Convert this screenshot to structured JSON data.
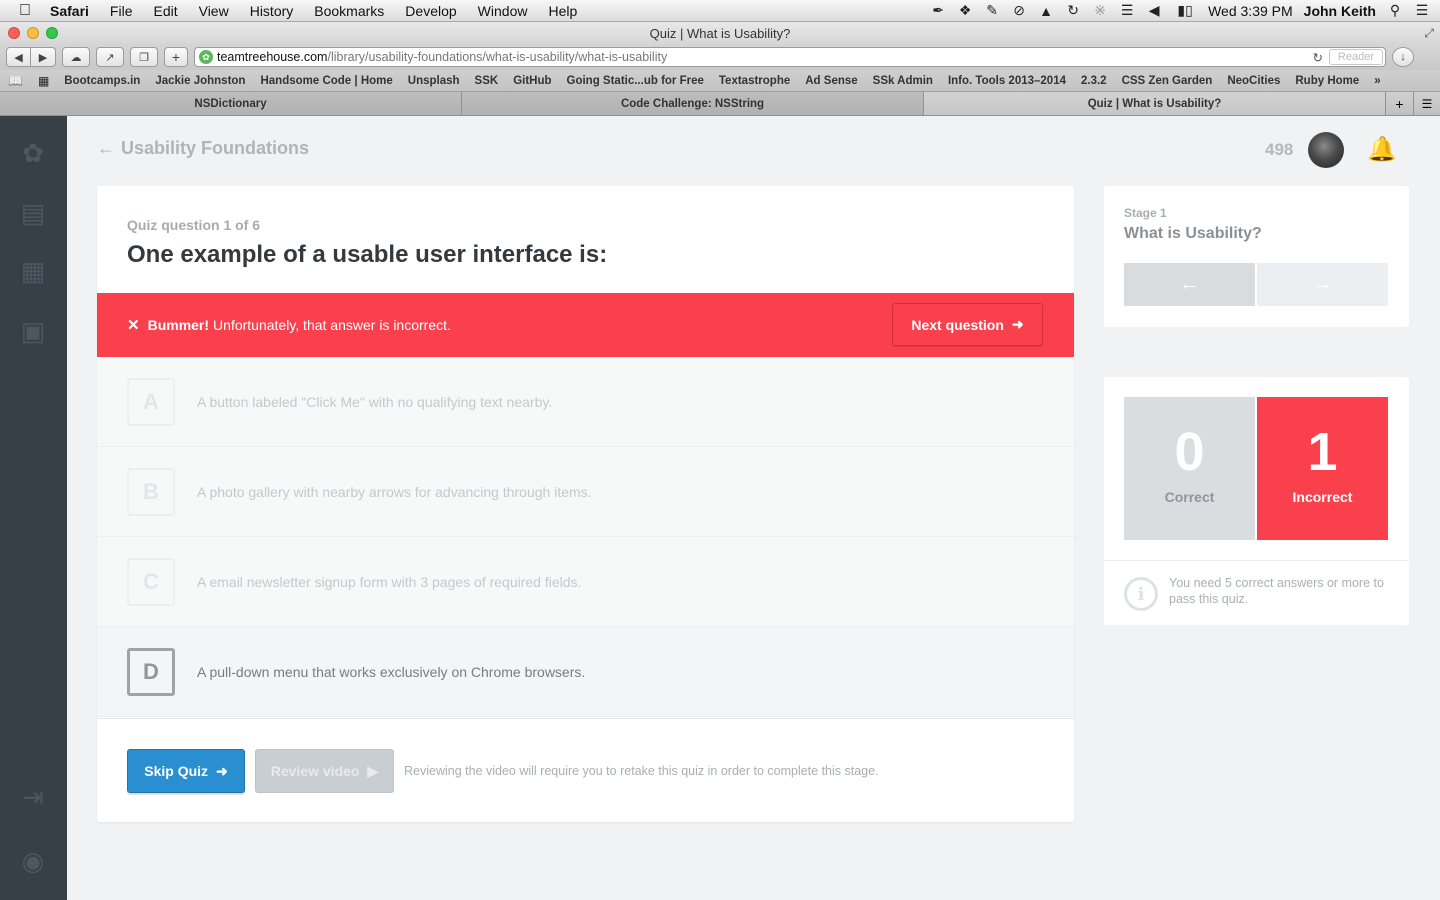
{
  "menubar": {
    "items": [
      "Safari",
      "File",
      "Edit",
      "View",
      "History",
      "Bookmarks",
      "Develop",
      "Window",
      "Help"
    ],
    "clock": "Wed 3:39 PM",
    "user": "John Keith"
  },
  "browser": {
    "window_title": "Quiz | What is Usability?",
    "url_host": "teamtreehouse.com",
    "url_path": "/library/usability-foundations/what-is-usability/what-is-usability",
    "reader_label": "Reader",
    "bookmarks": [
      "Bootcamps.in",
      "Jackie Johnston",
      "Handsome Code | Home",
      "Unsplash",
      "SSK",
      "GitHub",
      "Going Static...ub for Free",
      "Textastrophe",
      "Ad Sense",
      "SSk Admin",
      "Info. Tools 2013–2014",
      "2.3.2",
      "CSS Zen Garden",
      "NeoCities",
      "Ruby Home"
    ],
    "tabs": [
      "NSDictionary",
      "Code Challenge: NSString",
      "Quiz | What is Usability?"
    ]
  },
  "header": {
    "back_label": "Usability Foundations",
    "points": "498"
  },
  "quiz": {
    "counter": "Quiz question 1 of 6",
    "question": "One example of a usable user interface is:",
    "feedback_strong": "Bummer!",
    "feedback_text": "Unfortunately, that answer is incorrect.",
    "next_label": "Next question",
    "answers": [
      {
        "letter": "A",
        "text": "A button labeled \"Click Me\" with no qualifying text nearby."
      },
      {
        "letter": "B",
        "text": "A photo gallery with nearby arrows for advancing through items."
      },
      {
        "letter": "C",
        "text": "A email newsletter signup form with 3 pages of required fields."
      },
      {
        "letter": "D",
        "text": "A pull-down menu that works exclusively on Chrome browsers."
      }
    ],
    "selected_letter": "D",
    "skip_label": "Skip Quiz",
    "review_label": "Review video",
    "review_note": "Reviewing the video will require you to retake this quiz in order to complete this stage."
  },
  "stage": {
    "label": "Stage 1",
    "title": "What is Usability?"
  },
  "score": {
    "correct": "0",
    "correct_label": "Correct",
    "incorrect": "1",
    "incorrect_label": "Incorrect",
    "info": "You need 5 correct answers or more to pass this quiz."
  },
  "colors": {
    "error_red": "#fa3f4d",
    "primary_blue": "#2a8fd0",
    "sidebar": "#384047"
  }
}
